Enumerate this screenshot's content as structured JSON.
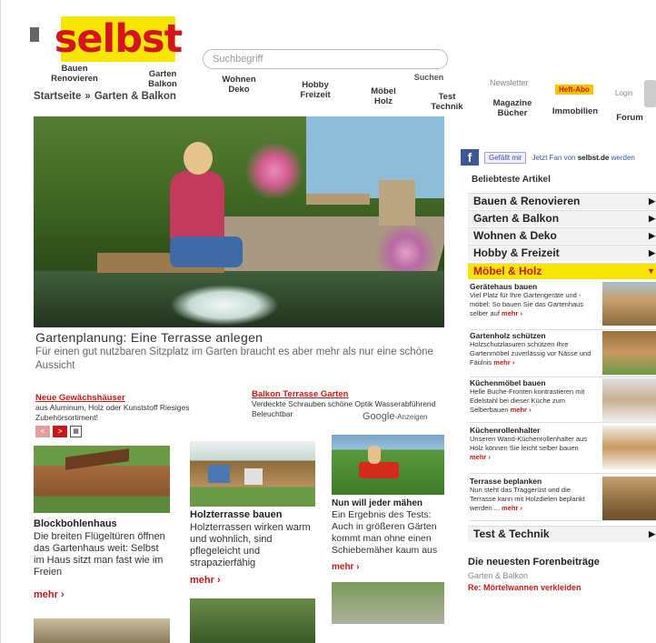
{
  "header": {
    "logo": "selbst",
    "search_placeholder": "Suchbegriff",
    "search_button": "Suchen",
    "newsletter": "Newsletter",
    "heft_abo": "Heft-Abo",
    "login": "Login"
  },
  "nav": [
    {
      "label": "Bauen\nRenovieren"
    },
    {
      "label": "Garten\nBalkon"
    },
    {
      "label": "Wohnen\nDeko"
    },
    {
      "label": "Hobby\nFreizeit"
    },
    {
      "label": "Möbel\nHolz"
    },
    {
      "label": "Test\nTechnik"
    },
    {
      "label": "Magazine\nBücher"
    },
    {
      "label": "Immobilien"
    },
    {
      "label": "Forum"
    }
  ],
  "breadcrumb": {
    "home": "Startseite",
    "sep": "»",
    "current": "Garten & Balkon"
  },
  "hero": {
    "title": "Gartenplanung: Eine Terrasse anlegen",
    "text": "Für einen gut nutzbaren Sitzplatz im Garten braucht es aber mehr als nur eine schöne Aussicht"
  },
  "ads": [
    {
      "title": "Neue Gewächshäuser",
      "text": "aus Aluminum, Holz oder Kunststoff Riesiges Zubehörsortiment!"
    },
    {
      "title": "Balkon Terrasse Garten",
      "text": "Verdeckte Schrauben schöne Optik Wasserabführend Beleuchtbar"
    }
  ],
  "google": {
    "brand": "Google",
    "suffix": "-Anzeigen"
  },
  "pager": {
    "prev": "<",
    "next": ">"
  },
  "cards": [
    {
      "title": "Blockbohlenhaus",
      "text": "Die breiten Flügeltüren öffnen das Gartenhaus weit: Selbst im Haus sitzt man fast wie im Freien",
      "more": "mehr ›"
    },
    {
      "title": "Holzterrasse bauen",
      "text": "Holzterrassen wirken warm und wohnlich, sind pflegeleicht und strapazierfähig",
      "more": "mehr ›"
    },
    {
      "title": "Nun will jeder mähen",
      "text": "Ein Ergebnis des Tests: Auch in größeren Gärten kommt man ohne einen Schiebemäher kaum aus",
      "more": "mehr ›"
    }
  ],
  "sidebar": {
    "fb_logo": "f",
    "fb_like": "Gefällt mir",
    "fb_text": "Jetzt Fan von ",
    "fb_site": "selbst.de",
    "fb_tail": " werden",
    "heading": "Beliebteste Artikel",
    "categories": [
      {
        "label": "Bauen & Renovieren"
      },
      {
        "label": "Garten & Balkon"
      },
      {
        "label": "Wohnen & Deko"
      },
      {
        "label": "Hobby & Freizeit"
      },
      {
        "label": "Möbel & Holz"
      }
    ],
    "items": [
      {
        "title": "Gerätehaus bauen",
        "text": "Viel Platz für Ihre Gartengeräte und -möbel: So bauen Sie das Gartenhaus selber auf",
        "more": "mehr ›"
      },
      {
        "title": "Gartenholz schützen",
        "text": "Holzschutzlasuren schützen Ihre Gartenmöbel zuverlässig vor Nässe und Fäulnis",
        "more": "mehr ›"
      },
      {
        "title": "Küchenmöbel bauen",
        "text": "Helle Buche-Fronten kontrastieren mit Edelstahl bei dieser Küche zum Selberbauen",
        "more": "mehr ›"
      },
      {
        "title": "Küchenrollenhalter",
        "text": "Unseren Wand-Küchenrollenhalter aus Holz können Sie leicht selber bauen",
        "more": "mehr ›"
      },
      {
        "title": "Terrasse beplanken",
        "text": "Nun steht das Traggerüst und die Terrasse kann mit Holzdielen beplankt werden ...",
        "more": "mehr ›"
      }
    ],
    "test_technik": "Test & Technik",
    "forum_title": "Die neuesten Forenbeiträge",
    "forum_sub": "Garten & Balkon",
    "forum_link": "Re: Mörtelwannen verkleiden"
  },
  "colors": {
    "brand_red": "#d4141a",
    "brand_yellow": "#f7e600",
    "link_red": "#c41a1a"
  }
}
